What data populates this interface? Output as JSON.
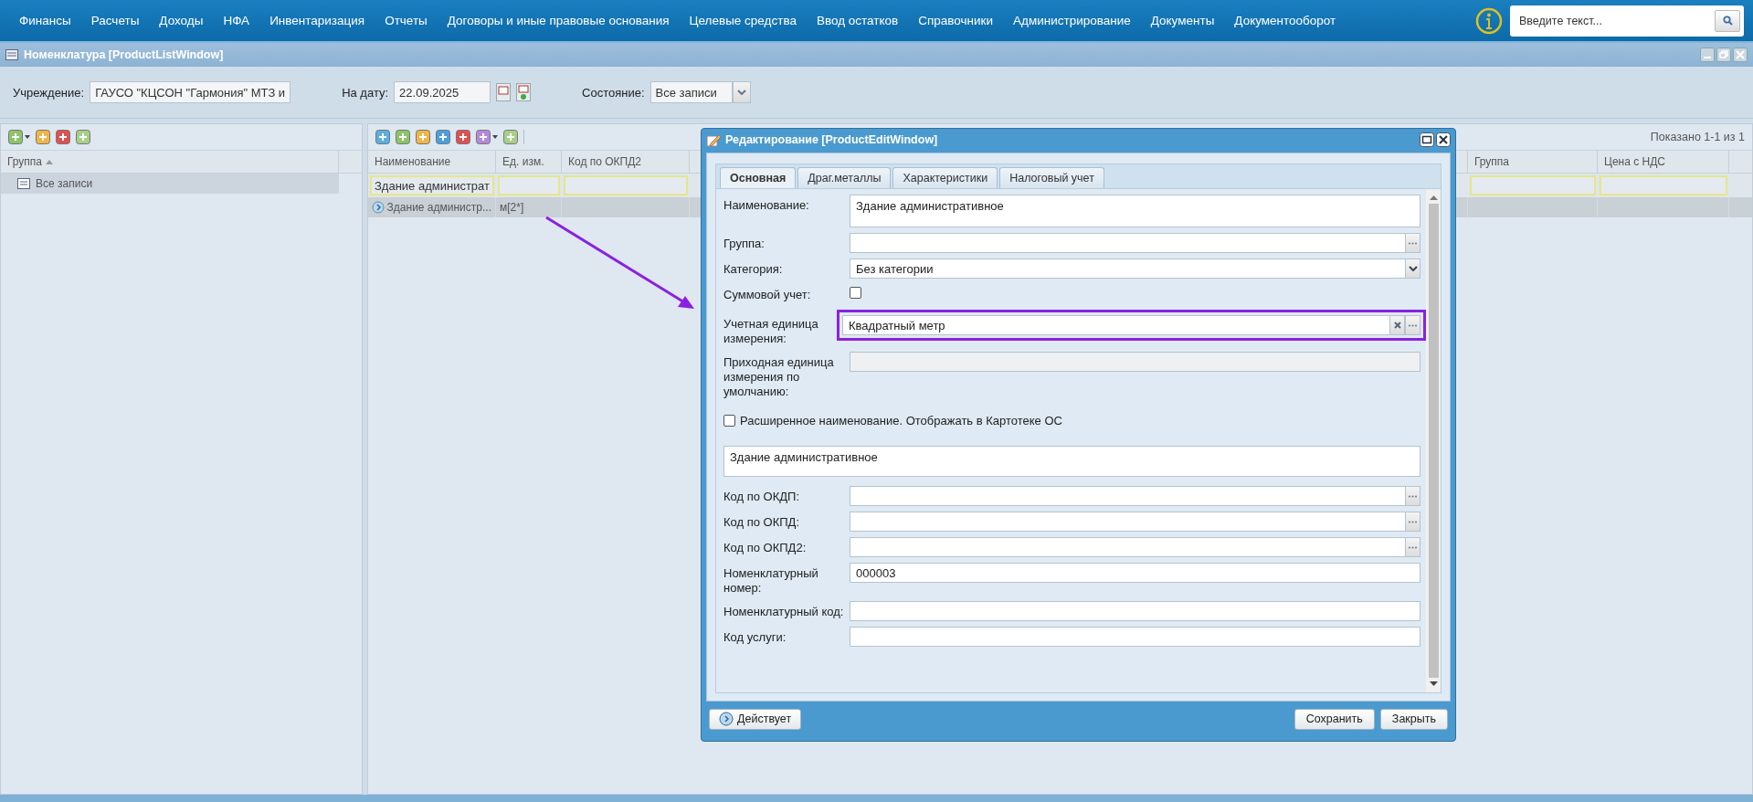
{
  "menu": [
    "Финансы",
    "Расчеты",
    "Доходы",
    "НФА",
    "Инвентаризация",
    "Отчеты",
    "Договоры и иные правовые основания",
    "Целевые средства",
    "Ввод остатков",
    "Справочники",
    "Администрирование",
    "Документы",
    "Документооборот"
  ],
  "search": {
    "placeholder": "Введите текст..."
  },
  "window": {
    "title": "Номенклатура [ProductListWindow]"
  },
  "filters": [
    {
      "kind": "text",
      "label": "Учреждение:",
      "value": "ГАУСО \"КЦСОН \"Гармония\" МТЗ и"
    },
    {
      "kind": "date",
      "label": "На дату:",
      "value": "22.09.2025"
    },
    {
      "kind": "combo",
      "label": "Состояние:",
      "value": "Все записи"
    }
  ],
  "groups": {
    "column": "Группа",
    "items": [
      {
        "label": "Все записи",
        "selected": true
      }
    ]
  },
  "grid": {
    "summary": "Показано 1-1 из 1",
    "columns": [
      {
        "title": "Наименование",
        "filter": "Здание администрат"
      },
      {
        "title": "Ед. изм."
      },
      {
        "title": "Код по ОКПД2"
      },
      {
        "title": "Группа"
      },
      {
        "title": "Цена с НДС"
      }
    ],
    "rows": [
      {
        "selected": true,
        "cells": [
          "Здание администр...",
          "м[2*]"
        ]
      }
    ]
  },
  "dialog": {
    "title": "Редактирование [ProductEditWindow]",
    "tabs": [
      {
        "label": "Основная",
        "selected": true
      },
      {
        "label": "Драг.металлы",
        "selected": false
      },
      {
        "label": "Характеристики",
        "selected": false
      },
      {
        "label": "Налоговый учет",
        "selected": false
      }
    ],
    "fields": [
      {
        "kind": "textarea",
        "label": "Наименование:",
        "value": "Здание административное"
      },
      {
        "kind": "trigger",
        "label": "Группа:"
      },
      {
        "kind": "combo",
        "label": "Категория:",
        "value": "Без категории"
      },
      {
        "kind": "checkbox",
        "label": "Суммовой учет:",
        "checked": false
      },
      {
        "kind": "clear-trigger",
        "label": "Учетная единица измерения:",
        "value": "Квадратный метр",
        "highlighted": true
      },
      {
        "kind": "disabled",
        "label": "Приходная единица измерения по умолчанию:"
      },
      {
        "kind": "check-line",
        "label": "Расширенное наименование. Отображать в Картотеке ОС",
        "checked": false
      },
      {
        "kind": "note",
        "value": "Здание административное"
      },
      {
        "kind": "trigger",
        "label": "Код по ОКДП:"
      },
      {
        "kind": "trigger",
        "label": "Код по ОКПД:"
      },
      {
        "kind": "trigger",
        "label": "Код по ОКПД2:"
      },
      {
        "kind": "text",
        "label": "Номенклатурный номер:",
        "value": "000003"
      },
      {
        "kind": "text",
        "label": "Номенклатурный код:"
      },
      {
        "kind": "text",
        "label": "Код услуги:"
      }
    ],
    "status_button": "Действует",
    "buttons": [
      "Сохранить",
      "Закрыть"
    ]
  }
}
